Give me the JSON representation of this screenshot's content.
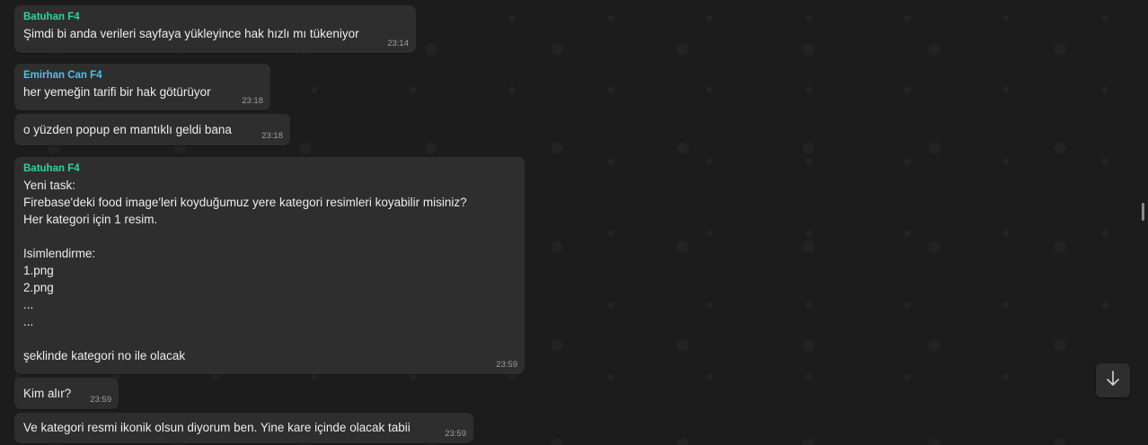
{
  "colors": {
    "sender_green": "#25d7a1",
    "sender_blue": "#53bdeb",
    "bubble_bg": "#2e2e2e",
    "chat_bg": "#1c1c1c"
  },
  "messages": [
    {
      "sender": "Batuhan F4",
      "text": "Şimdi bi anda verileri sayfaya yükleyince hak hızlı mı tükeniyor",
      "time": "23:14"
    },
    {
      "sender": "Emirhan Can F4",
      "text": "her yemeğin tarifi bir hak götürüyor",
      "time": "23:18"
    },
    {
      "sender": "",
      "text": "o yüzden popup en mantıklı geldi bana",
      "time": "23:18"
    },
    {
      "sender": "Batuhan F4",
      "text": "Yeni task:\nFirebase'deki food image'leri koyduğumuz yere kategori resimleri koyabilir misiniz? Her kategori için 1 resim.\n\nIsimlendirme:\n1.png\n2.png\n...\n...\n\nşeklinde kategori no ile olacak",
      "time": "23:59"
    },
    {
      "sender": "",
      "text": "Kim alır?",
      "time": "23:59"
    },
    {
      "sender": "",
      "text": "Ve kategori resmi ikonik olsun diyorum ben. Yine kare içinde olacak tabii",
      "time": "23:59"
    }
  ],
  "scroll_button_icon": "arrow-down-icon"
}
